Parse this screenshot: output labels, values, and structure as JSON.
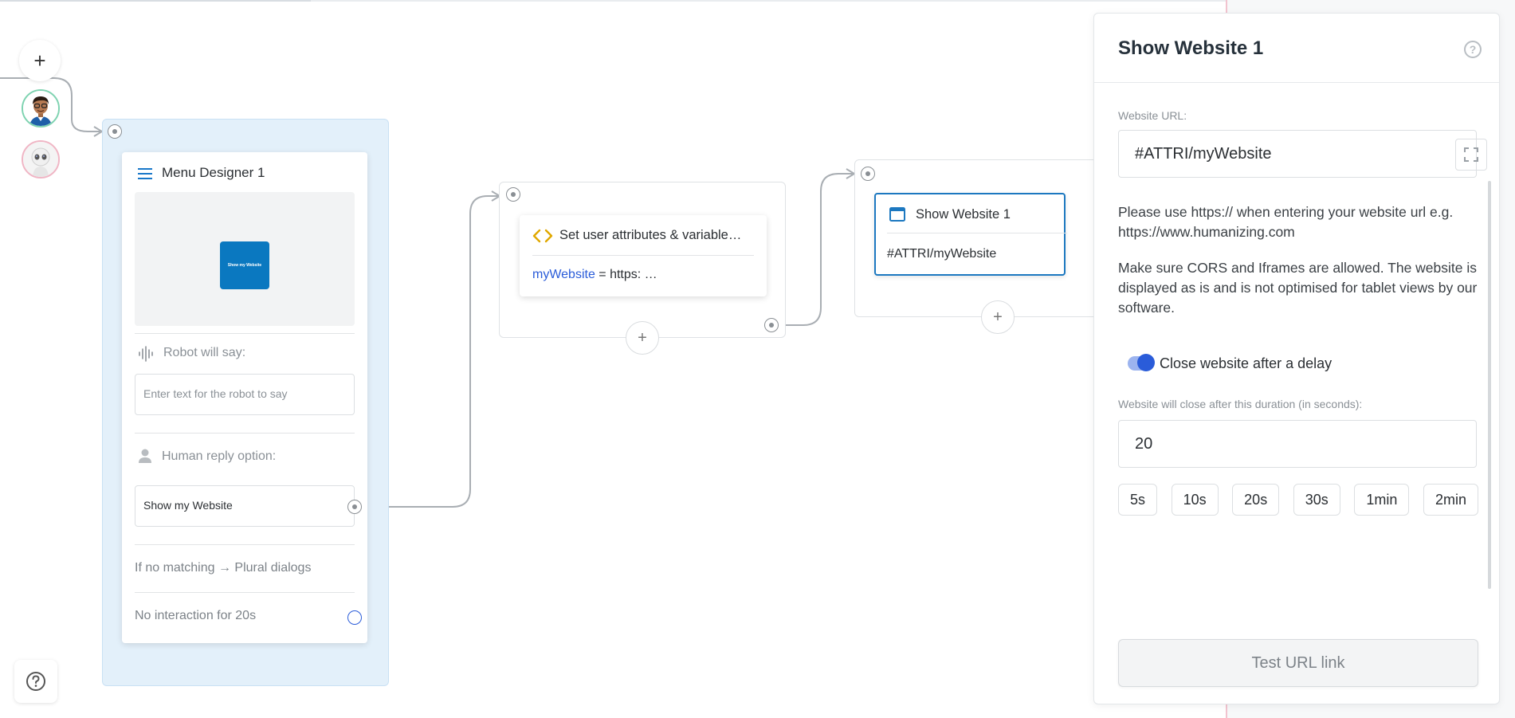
{
  "canvas": {
    "add_button": "+",
    "help_button": "?"
  },
  "menu_node": {
    "title": "Menu Designer 1",
    "preview_button_label": "Show my Website",
    "robot_say_label": "Robot will say:",
    "robot_say_placeholder": "Enter text for the robot to say",
    "human_reply_label": "Human reply option:",
    "human_reply_value": "Show my Website",
    "no_match_text": "If no matching → Plural dialogs",
    "no_interaction_text": "No interaction for 20s"
  },
  "variables_node": {
    "title": "Set user attributes & variable…",
    "variable_name": "myWebsite",
    "variable_rest": " = https: …",
    "add_button": "+"
  },
  "website_node": {
    "title": "Show Website 1",
    "url": "#ATTRI/myWebsite",
    "add_button": "+"
  },
  "panel": {
    "title": "Show Website 1",
    "help": "?",
    "url_label": "Website URL:",
    "url_value": "#ATTRI/myWebsite",
    "note_1": "Please use https:// when entering your website url e.g. https://www.humanizing.com",
    "note_2": "Make sure CORS and Iframes are allowed. The website is displayed as is and is not optimised for tablet views by our software.",
    "toggle_label": "Close website after a delay",
    "toggle_on": true,
    "duration_label": "Website will close after this duration (in seconds):",
    "duration_value": "20",
    "presets": [
      "5s",
      "10s",
      "20s",
      "30s",
      "1min",
      "2min"
    ],
    "test_button": "Test URL link"
  },
  "colors": {
    "accent_blue": "#1c78c0",
    "toggle_blue": "#2a5cd9",
    "group_bg": "#e3f0fa",
    "variable_blue": "#2a5cd9",
    "code_icon": "#e0a800"
  }
}
